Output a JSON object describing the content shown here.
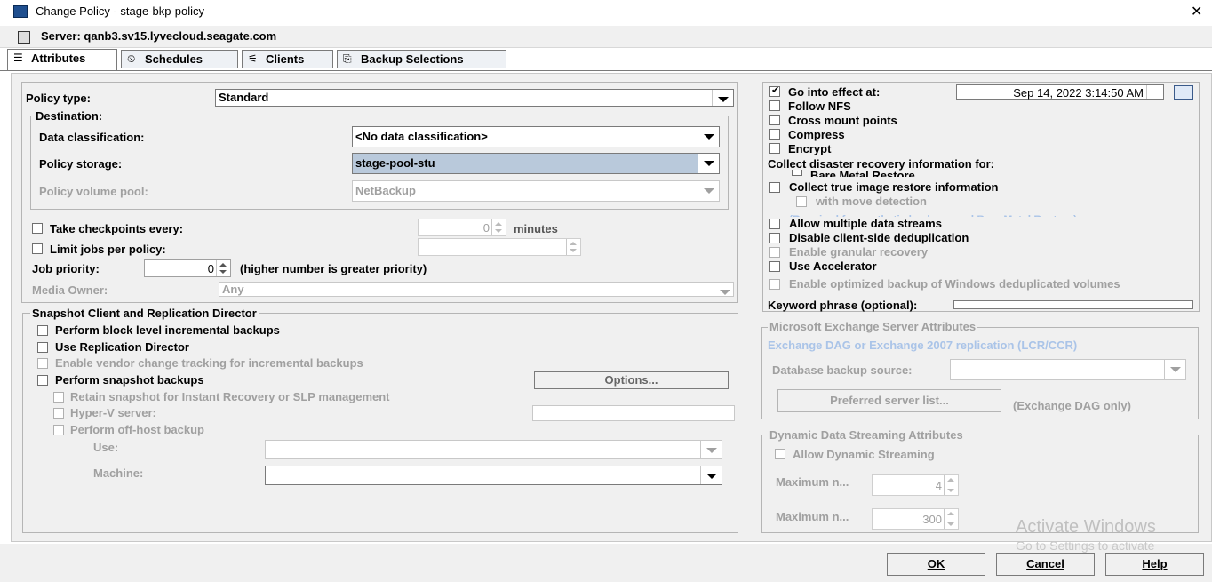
{
  "window": {
    "title": "Change Policy - stage-bkp-policy",
    "close_glyph": "✕"
  },
  "server": {
    "label": "Server: qanb3.sv15.lyvecloud.seagate.com"
  },
  "tabs": [
    {
      "label": "Attributes",
      "icon": "attributes-icon",
      "glyph": "☰"
    },
    {
      "label": "Schedules",
      "icon": "schedules-icon",
      "glyph": "⏲"
    },
    {
      "label": "Clients",
      "icon": "clients-icon",
      "glyph": "⚟"
    },
    {
      "label": "Backup Selections",
      "icon": "backup-selections-icon",
      "glyph": "⎘"
    }
  ],
  "left": {
    "policy_type_label": "Policy type:",
    "policy_type_value": "Standard",
    "destination_title": "Destination:",
    "data_class_label": "Data classification:",
    "data_class_value": "<No data classification>",
    "policy_storage_label": "Policy storage:",
    "policy_storage_value": "stage-pool-stu",
    "volume_pool_label": "Policy volume pool:",
    "volume_pool_value": "NetBackup",
    "checkpoints_label": "Take checkpoints every:",
    "checkpoints_value": "0",
    "checkpoints_unit": "minutes",
    "limit_jobs_label": "Limit jobs per policy:",
    "job_priority_label": "Job priority:",
    "job_priority_value": "0",
    "job_priority_hint": "(higher number is greater priority)",
    "media_owner_label": "Media Owner:",
    "media_owner_value": "Any"
  },
  "snapshot": {
    "title": "Snapshot Client and Replication Director",
    "block_level": "Perform block level incremental backups",
    "replication_director": "Use Replication Director",
    "vendor_tracking": "Enable vendor change tracking for incremental backups",
    "snapshot_backups": "Perform snapshot backups",
    "options_button": "Options...",
    "retain_snapshot": "Retain snapshot for Instant Recovery or SLP management",
    "hyperv": "Hyper-V server:",
    "offhost": "Perform off-host backup",
    "use_label": "Use:",
    "machine_label": "Machine:"
  },
  "right": {
    "go_into_effect": "Go into effect at:",
    "go_into_effect_value": "Sep 14, 2022 3:14:50 AM",
    "follow_nfs": "Follow NFS",
    "cross_mount": "Cross mount points",
    "compress": "Compress",
    "encrypt": "Encrypt",
    "dr_info": "Collect disaster recovery information for:",
    "bare_metal": "Bare Metal Restore",
    "true_image": "Collect true image restore information",
    "move_detection": "with move detection",
    "required_note": "(Required for synthetic backups and Bare Metal Restore)",
    "multiple_streams": "Allow multiple data streams",
    "disable_dedup": "Disable client-side deduplication",
    "granular": "Enable granular recovery",
    "accelerator": "Use Accelerator",
    "optimized_backup": "Enable optimized backup of Windows deduplicated volumes",
    "keyword": "Keyword phrase (optional):"
  },
  "exchange": {
    "title": "Microsoft Exchange Server Attributes",
    "dag_label": "Exchange DAG or Exchange 2007 replication (LCR/CCR)",
    "db_source_label": "Database backup source:",
    "preferred_button": "Preferred server list...",
    "dag_only": "(Exchange DAG only)"
  },
  "dynamic": {
    "title": "Dynamic Data Streaming Attributes",
    "allow": "Allow Dynamic Streaming",
    "max1_label": "Maximum n...",
    "max1_value": "4",
    "max2_label": "Maximum n...",
    "max2_value": "300"
  },
  "footer": {
    "ok": "OK",
    "cancel": "Cancel",
    "help": "Help"
  },
  "watermark": {
    "line1": "Activate Windows",
    "line2": "Go to Settings to activate"
  },
  "colors": {
    "selected_bg": "#b9c9db",
    "disabled_text": "#a0a0a0",
    "blue_disabled": "#aac4e8"
  }
}
